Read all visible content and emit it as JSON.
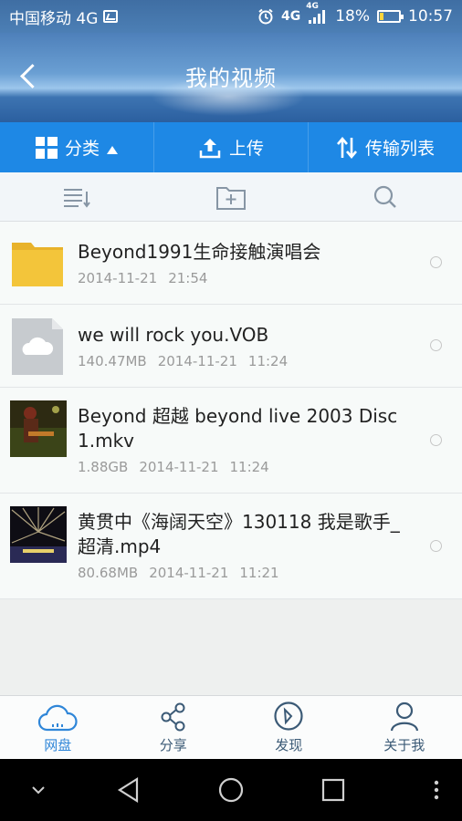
{
  "status_bar": {
    "carrier": "中国移动 4G",
    "network_1": "4G",
    "network_2": "4G",
    "battery": "18%",
    "battery_level": 0.18,
    "time": "10:57"
  },
  "header": {
    "title": "我的视频"
  },
  "toolbar": {
    "category_label": "分类",
    "upload_label": "上传",
    "transfer_label": "传输列表"
  },
  "files": [
    {
      "name": "Beyond1991生命接触演唱会",
      "size": "",
      "date": "2014-11-21",
      "time": "21:54",
      "kind": "folder"
    },
    {
      "name": "we will rock you.VOB",
      "size": "140.47MB",
      "date": "2014-11-21",
      "time": "11:24",
      "kind": "cloud"
    },
    {
      "name": "Beyond 超越 beyond live 2003 Disc 1.mkv",
      "size": "1.88GB",
      "date": "2014-11-21",
      "time": "11:24",
      "kind": "video"
    },
    {
      "name": "黄贯中《海阔天空》130118 我是歌手_超清.mp4",
      "size": "80.68MB",
      "date": "2014-11-21",
      "time": "11:21",
      "kind": "video"
    }
  ],
  "tabs": {
    "netdisk": "网盘",
    "share": "分享",
    "discover": "发现",
    "about_me": "关于我"
  },
  "colors": {
    "toolbar_blue": "#1e88e5",
    "active_tab": "#2f86d8",
    "folder_yellow": "#f3c53a"
  }
}
